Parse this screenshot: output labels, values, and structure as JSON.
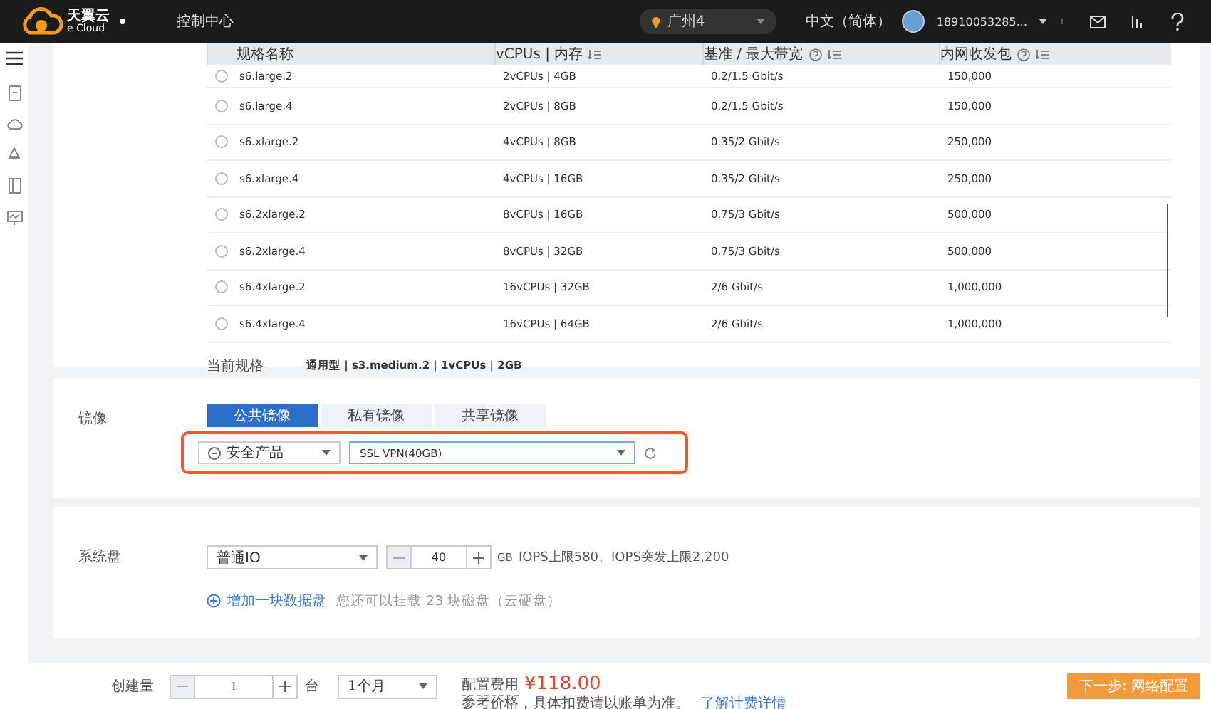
{
  "topbar": {
    "logo": "天翼云",
    "logo_sub": "e Cloud",
    "nav": "控制中心",
    "region": "广州4",
    "language": "中文（简体）",
    "user": "18910053285..."
  },
  "table": {
    "columns": [
      {
        "label": "规格名称",
        "help": false,
        "sortable": false
      },
      {
        "label": "vCPUs | 内存",
        "help": false,
        "sortable": true
      },
      {
        "label": "基准 / 最大带宽",
        "help": true,
        "sortable": true
      },
      {
        "label": "内网收发包",
        "help": true,
        "sortable": true
      }
    ],
    "rows": [
      {
        "selected": false,
        "cells": [
          "s6.large.2",
          "2vCPUs | 4GB",
          "0.2/1.5 Gbit/s",
          "150,000"
        ]
      },
      {
        "selected": false,
        "cells": [
          "s6.large.4",
          "2vCPUs | 8GB",
          "0.2/1.5 Gbit/s",
          "150,000"
        ]
      },
      {
        "selected": false,
        "cells": [
          "s6.xlarge.2",
          "4vCPUs | 8GB",
          "0.35/2 Gbit/s",
          "250,000"
        ]
      },
      {
        "selected": false,
        "cells": [
          "s6.xlarge.4",
          "4vCPUs | 16GB",
          "0.35/2 Gbit/s",
          "250,000"
        ]
      },
      {
        "selected": false,
        "cells": [
          "s6.2xlarge.2",
          "8vCPUs | 16GB",
          "0.75/3 Gbit/s",
          "500,000"
        ]
      },
      {
        "selected": false,
        "cells": [
          "s6.2xlarge.4",
          "8vCPUs | 32GB",
          "0.75/3 Gbit/s",
          "500,000"
        ]
      },
      {
        "selected": false,
        "cells": [
          "s6.4xlarge.2",
          "16vCPUs | 32GB",
          "2/6 Gbit/s",
          "1,000,000"
        ]
      },
      {
        "selected": false,
        "cells": [
          "s6.4xlarge.4",
          "16vCPUs | 64GB",
          "2/6 Gbit/s",
          "1,000,000"
        ]
      }
    ]
  },
  "current_spec": {
    "label": "当前规格",
    "value": "通用型 | s3.medium.2 | 1vCPUs | 2GB"
  },
  "image": {
    "label": "镜像",
    "tabs": [
      {
        "label": "公共镜像",
        "selected": true
      },
      {
        "label": "私有镜像",
        "selected": false
      },
      {
        "label": "共享镜像",
        "selected": false
      }
    ],
    "category": "安全产品",
    "image": "SSL VPN(40GB)"
  },
  "system_disk": {
    "label": "系统盘",
    "type": "普通IO",
    "size": "40",
    "unit": "GB",
    "info": "IOPS上限580、IOPS突发上限2,200",
    "add_link": "增加一块数据盘",
    "note": "您还可以挂载 23 块磁盘（云硬盘）"
  },
  "footer": {
    "quantity_label": "创建量",
    "quantity": "1",
    "quantity_unit": "台",
    "duration": "1个月",
    "price_label": "配置费用",
    "price": "¥118.00",
    "price_note": "参考价格，具体扣费请以账单为准。",
    "price_link": "了解计费详情",
    "next_button": "下一步: 网络配置"
  }
}
